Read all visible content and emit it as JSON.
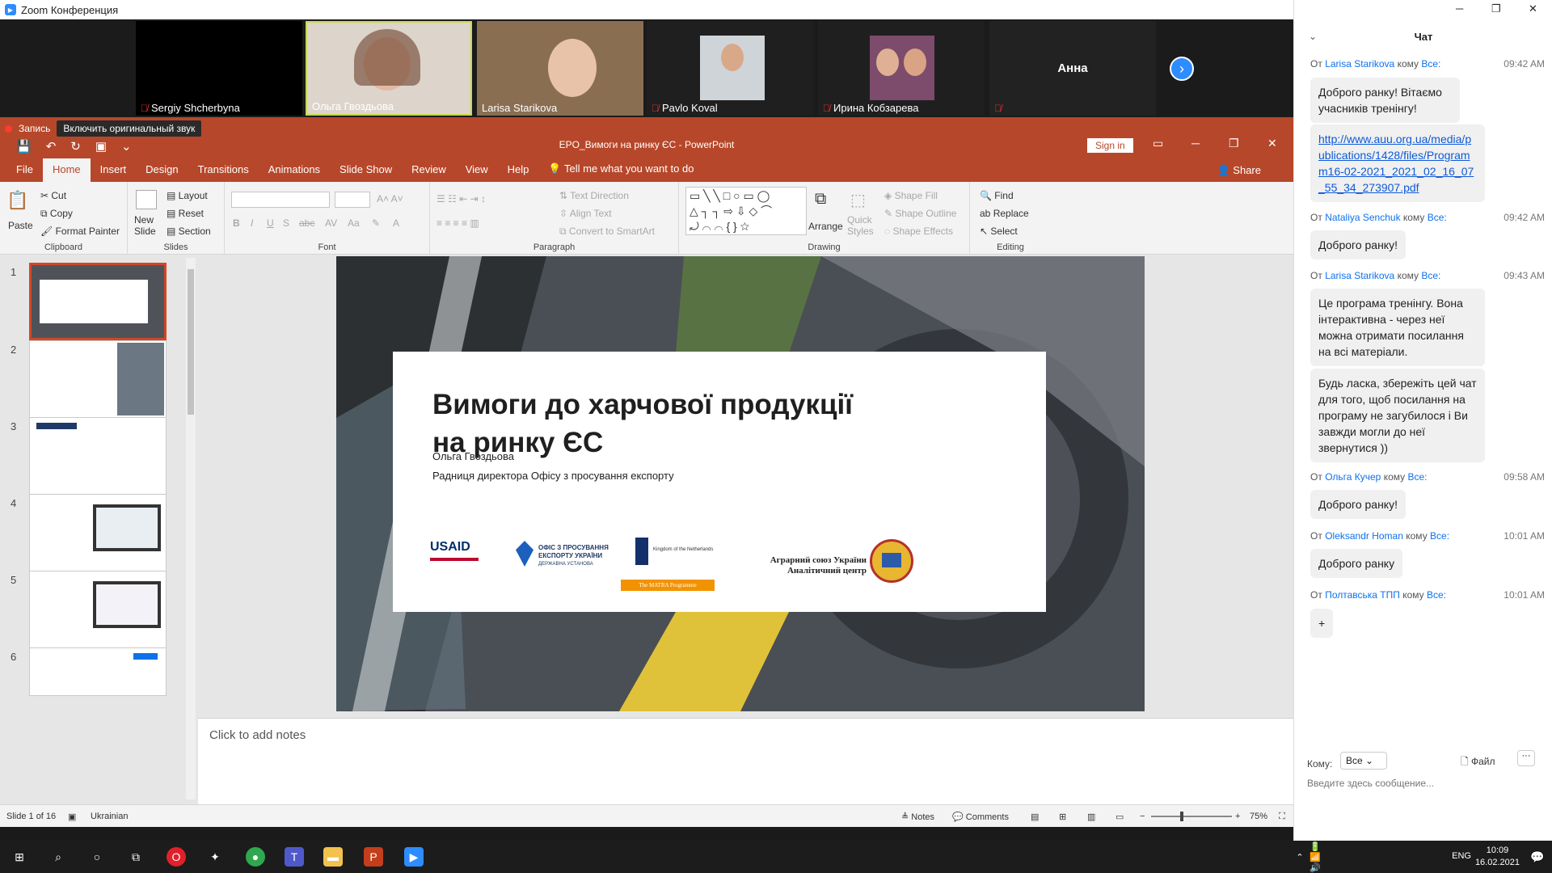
{
  "zoom": {
    "window_title": "Zoom Конференция",
    "participants": [
      {
        "name": "Sergiy Shcherbyna",
        "muted": true
      },
      {
        "name": "Ольга Гвоздьова",
        "muted": false
      },
      {
        "name": "Larisa Starikova",
        "muted": false
      },
      {
        "name": "Pavlo Koval",
        "muted": true
      },
      {
        "name": "Ирина Кобзарева",
        "muted": true
      },
      {
        "name": "Анна",
        "muted": true
      }
    ],
    "recording_label": "Запись",
    "original_sound_label": "Включить оригинальный звук"
  },
  "ppt": {
    "title": "EPO_Вимоги на ринку ЄС  -  PowerPoint",
    "sign_in": "Sign in",
    "share": "Share",
    "tabs": [
      "File",
      "Home",
      "Insert",
      "Design",
      "Transitions",
      "Animations",
      "Slide Show",
      "Review",
      "View",
      "Help"
    ],
    "tell_me": "Tell me what you want to do",
    "ribbon": {
      "paste": "Paste",
      "cut": "Cut",
      "copy": "Copy",
      "format_painter": "Format Painter",
      "clipboard": "Clipboard",
      "new_slide": "New Slide",
      "layout": "Layout",
      "reset": "Reset",
      "section": "Section",
      "slides": "Slides",
      "font": "Font",
      "paragraph": "Paragraph",
      "text_direction": "Text Direction",
      "align_text": "Align Text",
      "convert_smartart": "Convert to SmartArt",
      "arrange": "Arrange",
      "quick_styles": "Quick Styles",
      "shape_fill": "Shape Fill",
      "shape_outline": "Shape Outline",
      "shape_effects": "Shape Effects",
      "drawing": "Drawing",
      "find": "Find",
      "replace": "Replace",
      "select": "Select",
      "editing": "Editing"
    },
    "slide_numbers": [
      "1",
      "2",
      "3",
      "4",
      "5",
      "6"
    ],
    "slide": {
      "title_line1": "Вимоги до харчової продукції",
      "title_line2": "на ринку ЄС",
      "author": "Ольга Гвоздьова",
      "position": "Радниця директора Офісу з просування експорту",
      "logo_usaid": "USAID",
      "logo_epo": "ОФІС З ПРОСУВАННЯ ЕКСПОРТУ УКРАЇНИ",
      "logo_epo_sub": "ДЕРЖАВНА УСТАНОВА",
      "logo_nl": "Kingdom of the Netherlands",
      "logo_matra": "The MATRA Programme",
      "logo_auu_line1": "Аграрний союз України",
      "logo_auu_line2": "Аналітичний центр"
    },
    "notes_placeholder": "Click to add notes",
    "status": {
      "slide_of": "Slide 1 of 16",
      "language": "Ukrainian",
      "notes": "Notes",
      "comments": "Comments",
      "zoom": "75%"
    }
  },
  "chat": {
    "title": "Чат",
    "messages": [
      {
        "from_prefix": "От",
        "from": "Larisa Starikova",
        "to_prefix": "кому",
        "to": "Все:",
        "time": "09:42 AM",
        "texts": [
          "Доброго ранку! Вітаємо учасників тренінгу!",
          "http://www.auu.org.ua/media/publications/1428/files/Programm16-02-2021_2021_02_16_07_55_34_273907.pdf"
        ]
      },
      {
        "from_prefix": "От",
        "from": "Nataliya Senchuk",
        "to_prefix": "кому",
        "to": "Все:",
        "time": "09:42 AM",
        "texts": [
          "Доброго ранку!"
        ]
      },
      {
        "from_prefix": "От",
        "from": "Larisa Starikova",
        "to_prefix": "кому",
        "to": "Все:",
        "time": "09:43 AM",
        "texts": [
          "Це програма тренінгу. Вона інтерактивна - через неї можна отримати посилання на всі матеріали.",
          "Будь ласка, збережіть цей чат для того, щоб посилання на програму не загубилося і Ви завжди могли до неї звернутися ))"
        ]
      },
      {
        "from_prefix": "От",
        "from": "Ольга Кучер",
        "to_prefix": "кому",
        "to": "Все:",
        "time": "09:58 AM",
        "texts": [
          "Доброго ранку!"
        ]
      },
      {
        "from_prefix": "От",
        "from": "Oleksandr Homan",
        "to_prefix": "кому",
        "to": "Все:",
        "time": "10:01 AM",
        "texts": [
          "Доброго ранку"
        ]
      },
      {
        "from_prefix": "От",
        "from": "Полтавська ТПП",
        "to_prefix": "кому",
        "to": "Все:",
        "time": "10:01 AM",
        "texts": [
          "+"
        ]
      }
    ],
    "to_label": "Кому:",
    "to_value": "Все",
    "file_label": "Файл",
    "input_placeholder": "Введите здесь сообщение..."
  },
  "taskbar": {
    "language": "ENG",
    "time": "10:09",
    "date": "16.02.2021"
  }
}
